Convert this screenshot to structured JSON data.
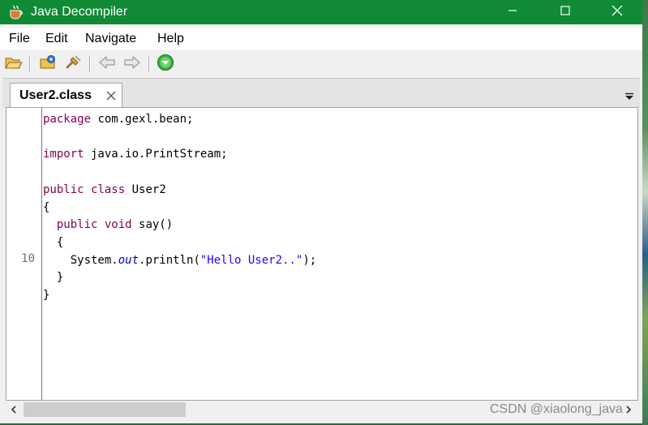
{
  "window": {
    "title": "Java Decompiler"
  },
  "menu": {
    "items": [
      "File",
      "Edit",
      "Navigate",
      "Help"
    ]
  },
  "toolbar": {
    "icons": [
      "open-file-icon",
      "open-type-icon",
      "search-icon",
      "back-arrow-icon",
      "forward-arrow-icon",
      "go-icon"
    ]
  },
  "tabs": [
    {
      "label": "User2.class"
    }
  ],
  "editor": {
    "line_numbers": [
      {
        "line": 7,
        "label": "10"
      }
    ],
    "lines": [
      [
        {
          "t": "package",
          "c": "kw"
        },
        {
          "t": " com.gexl.bean;"
        }
      ],
      [],
      [
        {
          "t": "import",
          "c": "kw"
        },
        {
          "t": " java.io.PrintStream;"
        }
      ],
      [],
      [
        {
          "t": "public",
          "c": "kw"
        },
        {
          "t": " "
        },
        {
          "t": "class",
          "c": "kw"
        },
        {
          "t": " User2"
        }
      ],
      [
        {
          "t": "{"
        }
      ],
      [
        {
          "t": "  "
        },
        {
          "t": "public",
          "c": "kw"
        },
        {
          "t": " "
        },
        {
          "t": "void",
          "c": "kw"
        },
        {
          "t": " say()"
        }
      ],
      [
        {
          "t": "  {"
        }
      ],
      [
        {
          "t": "    System."
        },
        {
          "t": "out",
          "c": "fld"
        },
        {
          "t": ".println("
        },
        {
          "t": "\"Hello User2..\"",
          "c": "str"
        },
        {
          "t": ");"
        }
      ],
      [
        {
          "t": "  }"
        }
      ],
      [
        {
          "t": "}"
        }
      ]
    ]
  },
  "watermark": "CSDN @xiaolong_java",
  "colors": {
    "titlebar": "#118a36",
    "keyword": "#7f0055",
    "string": "#2a00ff",
    "field": "#0000c0"
  }
}
